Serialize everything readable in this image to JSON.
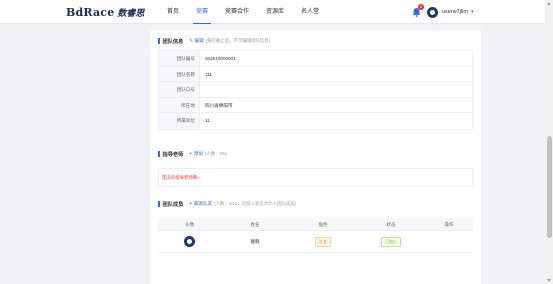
{
  "header": {
    "logo_latin": "BdRace",
    "logo_cjk": "数睿思",
    "nav": [
      {
        "label": "首页",
        "active": false
      },
      {
        "label": "竞赛",
        "active": true
      },
      {
        "label": "竞赛合作",
        "active": false
      },
      {
        "label": "资源库",
        "active": false
      },
      {
        "label": "名人堂",
        "active": false
      }
    ],
    "notification_count": "8",
    "username": "userw7jlim",
    "caret": "▾",
    "bell_icon": "bell-icon",
    "avatar_icon": "user-avatar"
  },
  "team_info": {
    "title": "团队信息",
    "edit_label": "编辑",
    "edit_hint": "(报名截止后，不可编辑团队信息)",
    "rows": [
      {
        "label": "团队编号",
        "value": "202510000001"
      },
      {
        "label": "团队名称",
        "value": "111"
      },
      {
        "label": "团队口号",
        "value": ""
      },
      {
        "label": "所在地",
        "value": "四川省绵阳市"
      },
      {
        "label": "所属单位",
        "value": "11"
      }
    ]
  },
  "mentor": {
    "title": "指导老师",
    "add_label": "添加",
    "count_hint": "(人数：0/5)",
    "empty_text": "还没有指导老师哦~"
  },
  "members": {
    "title": "团队成员",
    "add_label": "邀请队友",
    "count_hint": "(人数：1/15，已加入状态才计入团队成员)",
    "columns": [
      "头像",
      "姓名",
      "角色",
      "状态",
      "操作"
    ],
    "rows": [
      {
        "name": "靓靓",
        "role": "队长",
        "status": "已加入",
        "action": ""
      }
    ]
  },
  "colors": {
    "accent": "#2e6be6",
    "danger": "#f5222d",
    "role_tag": "#fa8c16",
    "status_tag": "#52c41a"
  }
}
